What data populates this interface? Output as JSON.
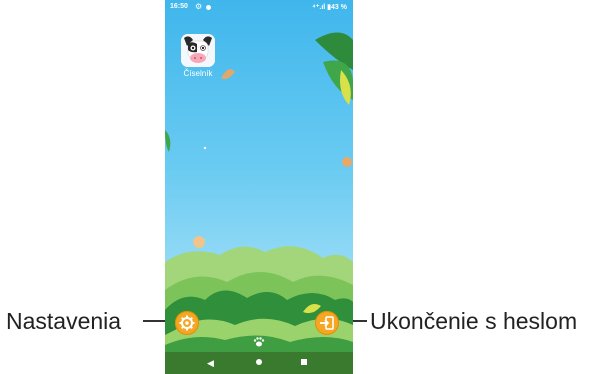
{
  "callouts": {
    "left": "Nastavenia",
    "right": "Ukončenie s heslom"
  },
  "status_bar": {
    "time": "16:50",
    "right_text": "⁴⁺.ıl ▮43 %"
  },
  "app": {
    "label": "Číselník",
    "icon": "cow-face-icon"
  },
  "buttons": {
    "settings": "gear-icon",
    "exit": "exit-door-icon"
  },
  "nav": {
    "back": "◀"
  },
  "colors": {
    "sky_top": "#3fb6ec",
    "button_orange": "#f5a623",
    "nav_green": "#3a7a2e"
  }
}
